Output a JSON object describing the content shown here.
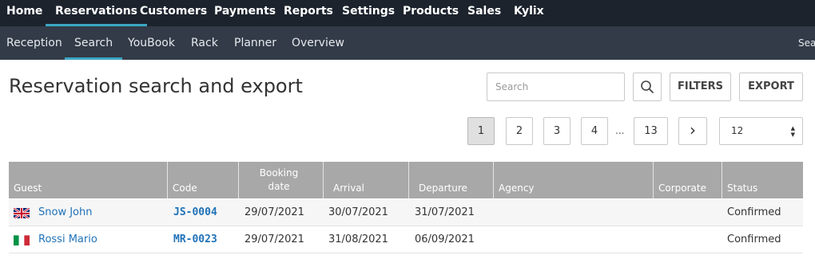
{
  "nav": {
    "items": [
      {
        "label": "Home"
      },
      {
        "label": "Reservations"
      },
      {
        "label": "Customers"
      },
      {
        "label": "Payments"
      },
      {
        "label": "Reports"
      },
      {
        "label": "Settings"
      },
      {
        "label": "Products"
      },
      {
        "label": "Sales"
      },
      {
        "label": "Kylix"
      }
    ]
  },
  "subnav": {
    "items": [
      {
        "label": "Reception"
      },
      {
        "label": "Search"
      },
      {
        "label": "YouBook"
      },
      {
        "label": "Rack"
      },
      {
        "label": "Planner"
      },
      {
        "label": "Overview"
      }
    ],
    "right_label": "Sea"
  },
  "page": {
    "title": "Reservation search and export"
  },
  "toolbar": {
    "search_placeholder": "Search",
    "filters_label": "FILTERS",
    "export_label": "EXPORT"
  },
  "pagination": {
    "pages": [
      "1",
      "2",
      "3",
      "4"
    ],
    "ellipsis": "...",
    "last_page": "13",
    "next_symbol": "›",
    "page_size": "12"
  },
  "table": {
    "columns": {
      "guest": "Guest",
      "code": "Code",
      "booking_date": "Booking date",
      "arrival": "Arrival",
      "departure": "Departure",
      "agency": "Agency",
      "corporate": "Corporate",
      "status": "Status"
    },
    "rows": [
      {
        "flag": "uk-flag-icon",
        "guest": "Snow John",
        "code": "JS-0004",
        "booking_date": "29/07/2021",
        "arrival": "30/07/2021",
        "departure": "31/07/2021",
        "agency": "",
        "corporate": "",
        "status": "Confirmed"
      },
      {
        "flag": "italy-flag-icon",
        "guest": "Rossi Mario",
        "code": "MR-0023",
        "booking_date": "29/07/2021",
        "arrival": "31/08/2021",
        "departure": "06/09/2021",
        "agency": "",
        "corporate": "",
        "status": "Confirmed"
      }
    ]
  },
  "colors": {
    "topnav_bg": "#1c232d",
    "subnav_bg": "#323b47",
    "accent": "#3aa6c4",
    "link": "#1f72b8",
    "table_header_bg": "#a8a8a8"
  }
}
